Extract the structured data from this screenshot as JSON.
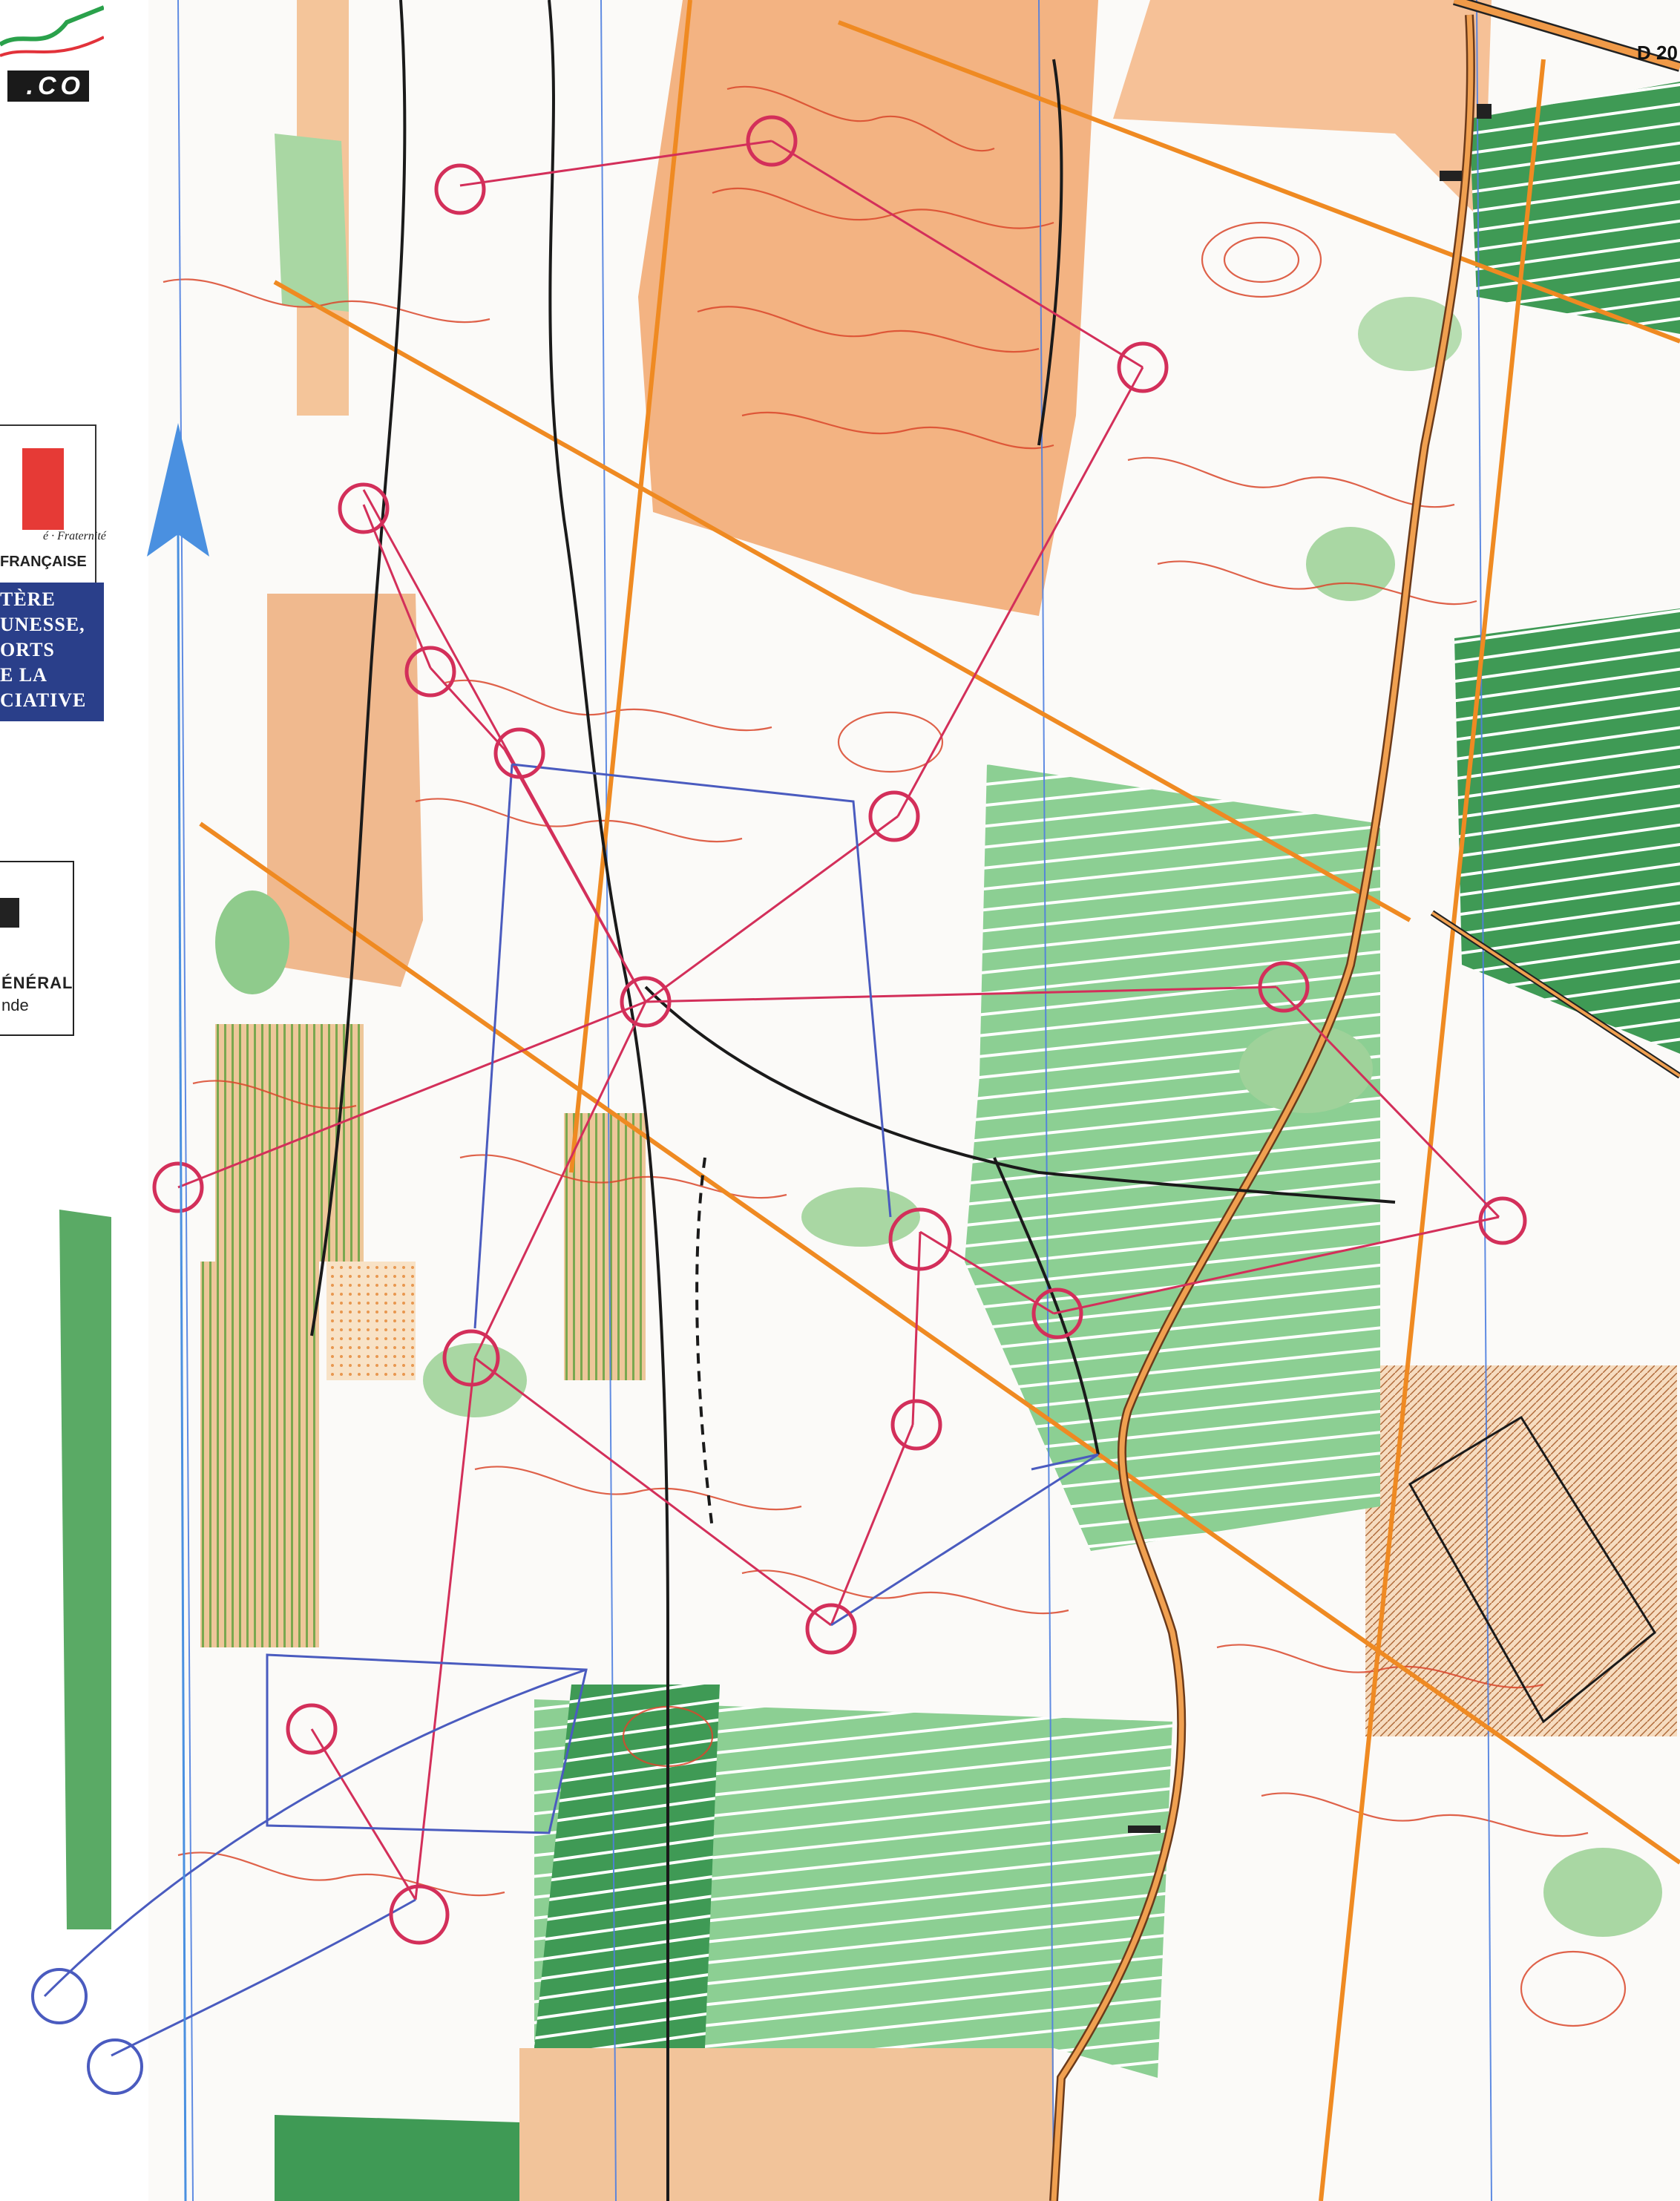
{
  "map": {
    "type": "orienteering map",
    "colors": {
      "open_land": "#f4b47e",
      "rough_open": "#f8d6b0",
      "vegetation_green": "#3c9a4a",
      "light_green": "#a9d7a3",
      "contours": "#d9472b",
      "course_overprint": "#d32f5a",
      "route_pen": "#4a5bbf",
      "magnetic_north_lines": "#4f7fe0",
      "roads": "#e07a1c",
      "power_lines": "#ff8a00",
      "tracks": "#1a1a1a",
      "north_arrow": "#4a90e0"
    },
    "road_label": "D 20",
    "club_logo_text": ".CO",
    "flag_motto": "é · Fraternité",
    "flag_caption": "FRANÇAISE",
    "ministry_lines": [
      "TÈRE",
      "UNESSE,",
      "ORTS",
      "E LA",
      "CIATIVE"
    ],
    "sponsor_lines": [
      "ÉNÉRAL",
      "nde"
    ],
    "icons": [
      "north-arrow-icon",
      "control-circle-icon",
      "building-icon"
    ]
  }
}
